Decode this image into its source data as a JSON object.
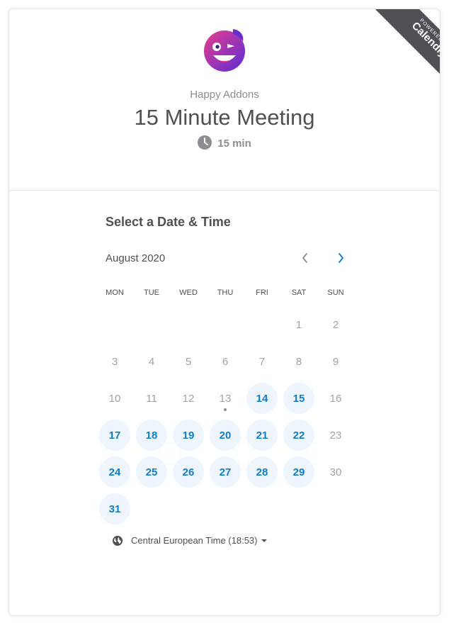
{
  "header": {
    "org_name": "Happy Addons",
    "event_title": "15 Minute Meeting",
    "duration": "15 min"
  },
  "ribbon": {
    "top_text": "POWERED BY",
    "brand": "Calendly"
  },
  "calendar": {
    "section_title": "Select a Date & Time",
    "month_label": "August 2020",
    "weekdays": [
      "MON",
      "TUE",
      "WED",
      "THU",
      "FRI",
      "SAT",
      "SUN"
    ],
    "days": [
      {
        "n": "",
        "a": false
      },
      {
        "n": "",
        "a": false
      },
      {
        "n": "",
        "a": false
      },
      {
        "n": "",
        "a": false
      },
      {
        "n": "",
        "a": false
      },
      {
        "n": "1",
        "a": false
      },
      {
        "n": "2",
        "a": false
      },
      {
        "n": "3",
        "a": false
      },
      {
        "n": "4",
        "a": false
      },
      {
        "n": "5",
        "a": false
      },
      {
        "n": "6",
        "a": false
      },
      {
        "n": "7",
        "a": false
      },
      {
        "n": "8",
        "a": false
      },
      {
        "n": "9",
        "a": false
      },
      {
        "n": "10",
        "a": false
      },
      {
        "n": "11",
        "a": false
      },
      {
        "n": "12",
        "a": false
      },
      {
        "n": "13",
        "a": false,
        "today": true
      },
      {
        "n": "14",
        "a": true
      },
      {
        "n": "15",
        "a": true
      },
      {
        "n": "16",
        "a": false
      },
      {
        "n": "17",
        "a": true
      },
      {
        "n": "18",
        "a": true
      },
      {
        "n": "19",
        "a": true
      },
      {
        "n": "20",
        "a": true
      },
      {
        "n": "21",
        "a": true
      },
      {
        "n": "22",
        "a": true
      },
      {
        "n": "23",
        "a": false
      },
      {
        "n": "24",
        "a": true
      },
      {
        "n": "25",
        "a": true
      },
      {
        "n": "26",
        "a": true
      },
      {
        "n": "27",
        "a": true
      },
      {
        "n": "28",
        "a": true
      },
      {
        "n": "29",
        "a": true
      },
      {
        "n": "30",
        "a": false
      },
      {
        "n": "31",
        "a": true
      }
    ]
  },
  "timezone": {
    "label": "Central European Time (18:53)"
  },
  "colors": {
    "accent": "#0e7ccf",
    "available_bg": "#eef5fd",
    "ribbon": "#4d5055"
  }
}
